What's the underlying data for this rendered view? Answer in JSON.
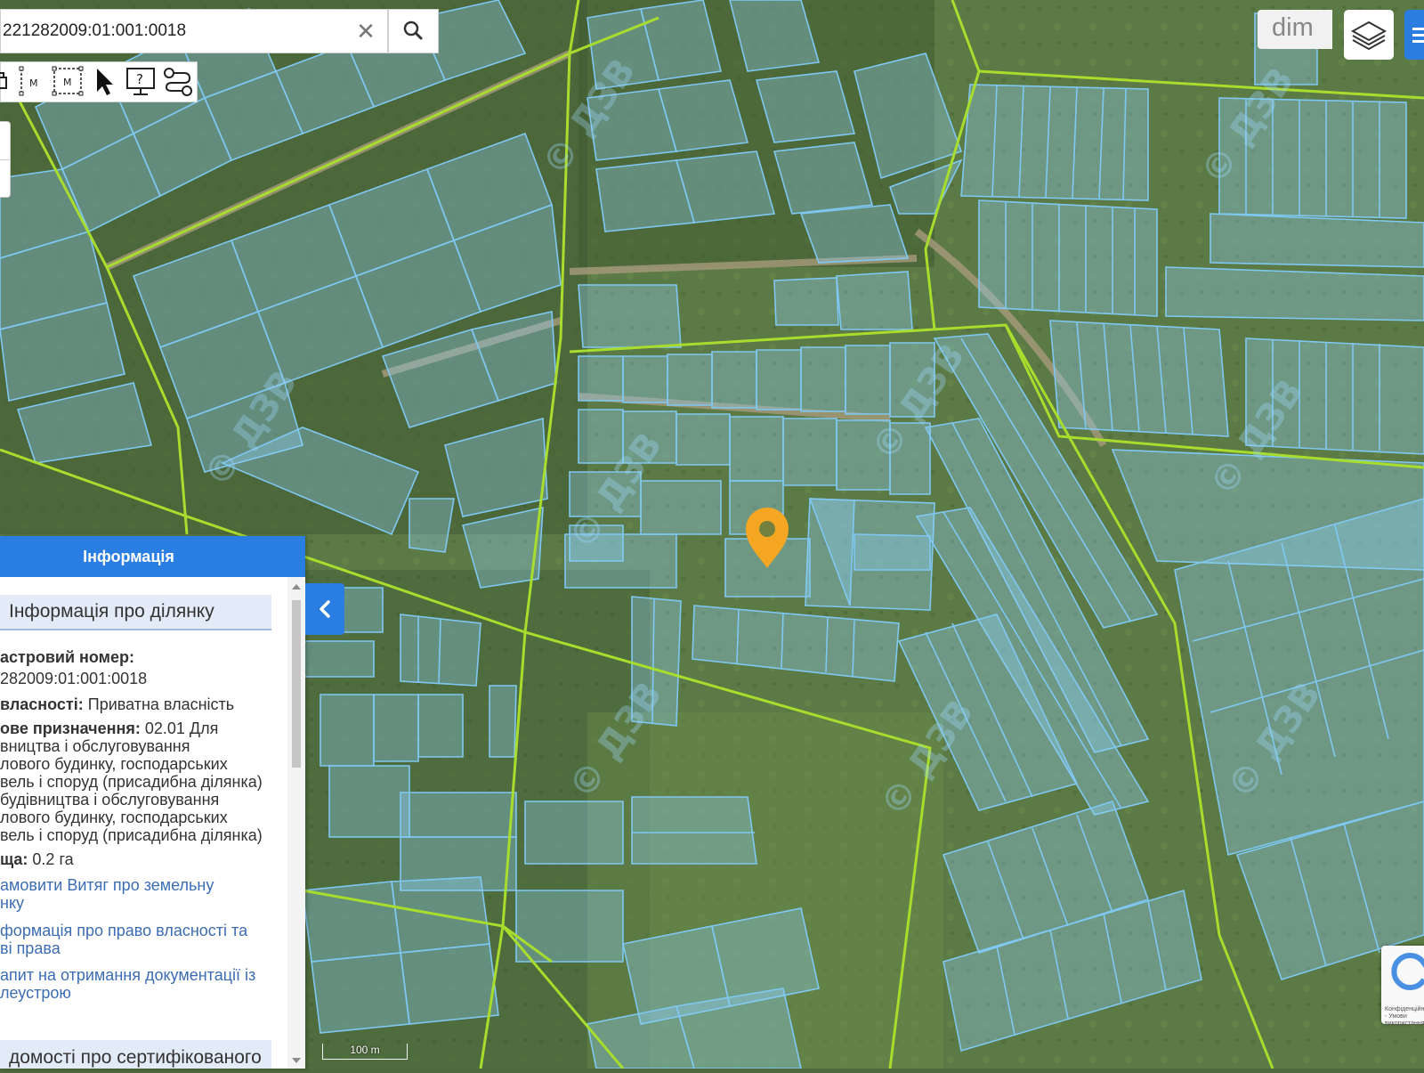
{
  "search": {
    "value": "221282009:01:001:0018",
    "clear_label": "✕"
  },
  "toolbar": {
    "tools": [
      {
        "name": "print-tool"
      },
      {
        "name": "measure-line-tool",
        "letter": "M"
      },
      {
        "name": "measure-area-tool",
        "letter": "M"
      },
      {
        "name": "select-pointer-tool"
      },
      {
        "name": "info-tool",
        "letter": "?"
      },
      {
        "name": "route-tool"
      }
    ]
  },
  "top_right": {
    "watermark_text": "dim"
  },
  "info_panel": {
    "header": "Інформація",
    "section_title": "Інформація про ділянку",
    "fields": [
      {
        "label": "астровий номер:",
        "value": ""
      },
      {
        "label": "",
        "value": "282009:01:001:0018"
      },
      {
        "label": "власності:",
        "value": " Приватна власність"
      },
      {
        "label": "ове призначення:",
        "value": " 02.01 Для"
      },
      {
        "label": "",
        "value": "вництва і обслуговування"
      },
      {
        "label": "",
        "value": "лового будинку, господарських"
      },
      {
        "label": "",
        "value": "вель і споруд (присадибна ділянка)"
      },
      {
        "label": "",
        "value": "будівництва і обслуговування"
      },
      {
        "label": "",
        "value": "лового будинку, господарських"
      },
      {
        "label": "",
        "value": "вель і споруд (присадибна ділянка)"
      },
      {
        "label": "ща:",
        "value": " 0.2 га"
      }
    ],
    "links": [
      {
        "line1": "амовити Витяг про земельну",
        "line2": "нку"
      },
      {
        "line1": "формація про право власності та",
        "line2": "ві права"
      },
      {
        "line1": "апит на отримання документації із",
        "line2": "леустрою"
      }
    ],
    "section_title2": "домості про сертифікованого"
  },
  "map": {
    "scale_label": "100 m",
    "watermark": "© ДЗВ",
    "marker_color": "#f5a623",
    "parcel_color": "#7fc8f2",
    "boundary_color": "#a8dd2e"
  },
  "recaptcha": {
    "text": "Конфіденційність - Умови використання"
  }
}
